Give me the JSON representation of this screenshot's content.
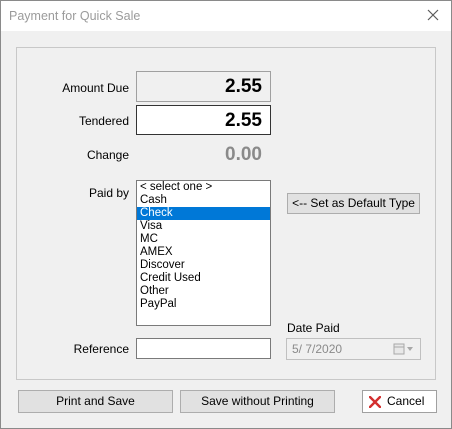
{
  "window": {
    "title": "Payment for Quick Sale",
    "close_icon": "close-icon"
  },
  "form": {
    "amount_due_label": "Amount Due",
    "amount_due_value": "2.55",
    "tendered_label": "Tendered",
    "tendered_value": "2.55",
    "change_label": "Change",
    "change_value": "0.00",
    "paid_by_label": "Paid by",
    "payment_types": [
      "< select one >",
      "Cash",
      "Check",
      "Visa",
      "MC",
      "AMEX",
      "Discover",
      "Credit Used",
      "Other",
      "PayPal"
    ],
    "selected_type": "Check",
    "set_default_label": "<-- Set as Default Type",
    "date_paid_label": "Date Paid",
    "date_paid_value": "5/  7/2020",
    "reference_label": "Reference",
    "reference_value": ""
  },
  "buttons": {
    "print_and_save": "Print and Save",
    "save_without_printing": "Save without Printing",
    "cancel": "Cancel"
  },
  "colors": {
    "selection": "#0078d7",
    "cancel_icon": "#d32f2f"
  }
}
